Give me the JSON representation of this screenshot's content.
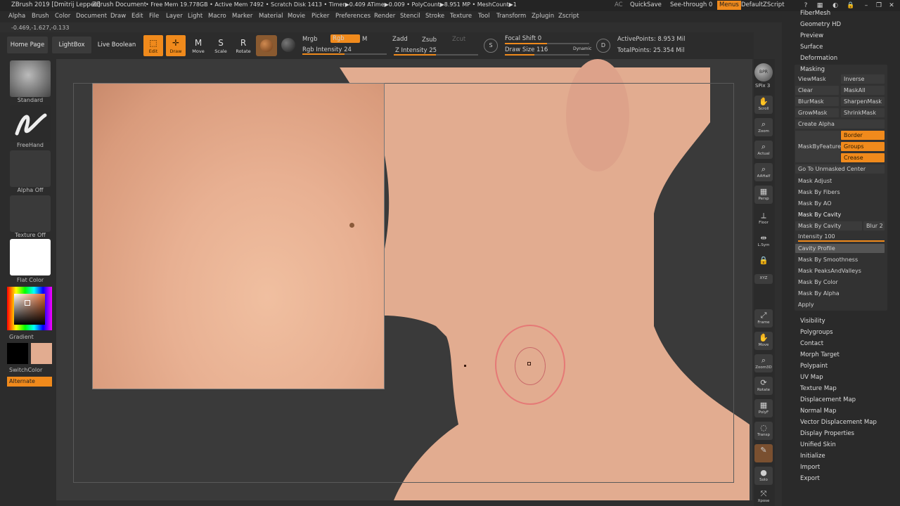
{
  "titlebar": {
    "app_title": "ZBrush 2019 [Dmitrij Leppee]",
    "document": "ZBrush Document",
    "stats": "• Free Mem 19.778GB • Active Mem 7492 • Scratch Disk 1413 • Timer▶0.409 ATime▶0.009 • PolyCount▶8.951 MP • MeshCount▶1",
    "ac": "AC",
    "quicksave": "QuickSave",
    "see_through": "See-through",
    "see_through_value": "0",
    "menus": "Menus",
    "script": "DefaultZScript"
  },
  "menubar": [
    "Alpha",
    "Brush",
    "Color",
    "Document",
    "Draw",
    "Edit",
    "File",
    "Layer",
    "Light",
    "Macro",
    "Marker",
    "Material",
    "Movie",
    "Picker",
    "Preferences",
    "Render",
    "Stencil",
    "Stroke",
    "Texture",
    "Tool",
    "Transform",
    "Zplugin",
    "Zscript"
  ],
  "coords": "-0.469,-1.627,-0.133",
  "shelf": {
    "home_page": "Home Page",
    "lightbox": "LightBox",
    "live_boolean": "Live Boolean",
    "edit": "Edit",
    "draw": "Draw",
    "move": "Move",
    "scale": "Scale",
    "rotate": "Rotate",
    "mrgb": "Mrgb",
    "rgb": "Rgb",
    "m": "M",
    "rgb_intensity": "Rgb Intensity 24",
    "zadd": "Zadd",
    "zsub": "Zsub",
    "zcut": "Zcut",
    "z_intensity": "Z Intensity 25",
    "focal_shift": "Focal Shift 0",
    "draw_size": "Draw Size 116",
    "dynamic": "Dynamic",
    "active_points": "ActivePoints: 8.953 Mil",
    "total_points": "TotalPoints: 25.354 Mil"
  },
  "lefttray": {
    "brush": "Standard",
    "stroke": "FreeHand",
    "alpha": "Alpha Off",
    "texture": "Texture Off",
    "material": "Flat Color",
    "gradient": "Gradient",
    "switchcolor": "SwitchColor",
    "alternate": "Alternate"
  },
  "rstrip": {
    "bpr": "BPR",
    "spix": "SPix 3",
    "items": [
      "Scroll",
      "Zoom",
      "Actual",
      "AAHalf",
      "Persp",
      "Floor",
      "L.Sym",
      "Local",
      "XYZ",
      "Frame",
      "Move",
      "Zoom3D",
      "Rotate",
      "PolyF",
      "Transp",
      "Ghost",
      "Solo",
      "Xpose"
    ]
  },
  "rpanel": {
    "top_items": [
      "FiberMesh",
      "Geometry HD",
      "Preview",
      "Surface",
      "Deformation"
    ],
    "masking": {
      "title": "Masking",
      "view_mask": "ViewMask",
      "inverse": "Inverse",
      "clear": "Clear",
      "mask_all": "MaskAll",
      "blur_mask": "BlurMask",
      "sharpen_mask": "SharpenMask",
      "grow_mask": "GrowMask",
      "shrink_mask": "ShrinkMask",
      "create_alpha": "Create Alpha",
      "mask_by_feature": "MaskByFeature",
      "border": "Border",
      "groups": "Groups",
      "crease": "Crease",
      "go_unmasked": "Go To Unmasked Center",
      "mask_adjust": "Mask Adjust",
      "mask_fibers": "Mask By Fibers",
      "mask_ao": "Mask By AO",
      "mask_cavity_header": "Mask By Cavity",
      "mask_cavity": "Mask By Cavity",
      "blur": "Blur 2",
      "intensity": "Intensity 100",
      "cavity_profile": "Cavity Profile",
      "mask_smoothness": "Mask By Smoothness",
      "mask_peaks": "Mask PeaksAndValleys",
      "mask_color": "Mask By Color",
      "mask_alpha": "Mask By Alpha",
      "apply": "Apply"
    },
    "bottom_items": [
      "Visibility",
      "Polygroups",
      "Contact",
      "Morph Target",
      "Polypaint",
      "UV Map",
      "Texture Map",
      "Displacement Map",
      "Normal Map",
      "Vector Displacement Map",
      "Display Properties",
      "Unified Skin",
      "Initialize",
      "Import",
      "Export"
    ]
  },
  "colors": {
    "accent": "#f08a1c",
    "skin": "#e2ac90",
    "background": "#2f2f2f"
  }
}
